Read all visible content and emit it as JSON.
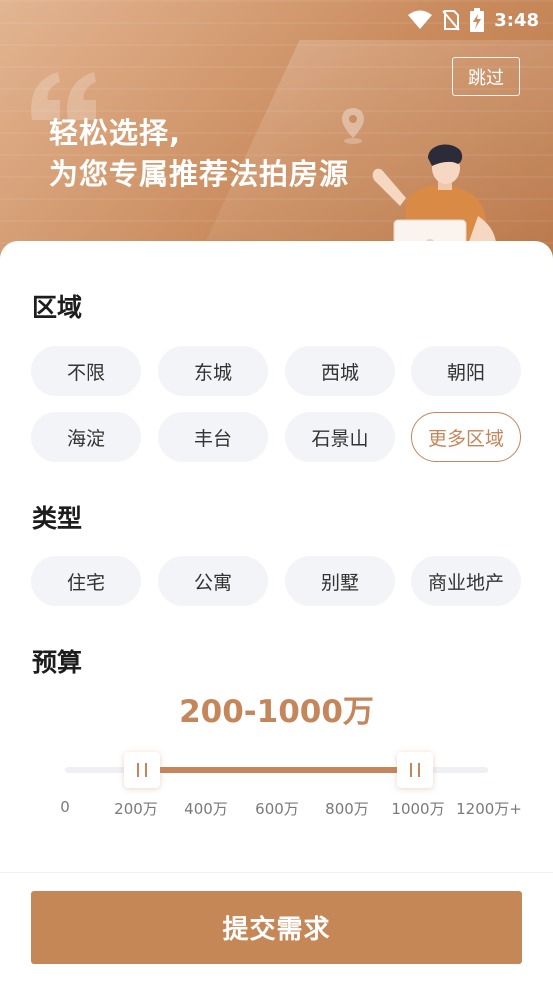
{
  "status_bar": {
    "time": "3:48"
  },
  "header": {
    "skip_label": "跳过",
    "headline_line1": "轻松选择,",
    "headline_line2": "为您专属推荐法拍房源"
  },
  "district": {
    "title": "区域",
    "options": [
      "不限",
      "东城",
      "西城",
      "朝阳",
      "海淀",
      "丰台",
      "石景山",
      "更多区域"
    ]
  },
  "type": {
    "title": "类型",
    "options": [
      "住宅",
      "公寓",
      "别墅",
      "商业地产"
    ]
  },
  "budget": {
    "title": "预算",
    "value": "200-1000万",
    "range_min": 0,
    "range_max": 1200,
    "selected_low": 200,
    "selected_high": 1000,
    "ticks": [
      "0",
      "200万",
      "400万",
      "600万",
      "800万",
      "1000万",
      "1200万+"
    ]
  },
  "submit_label": "提交需求",
  "colors": {
    "accent": "#c4865a",
    "chip_bg": "#f3f4f7",
    "button": "#c68757"
  },
  "icons": [
    "wifi-icon",
    "no-sim-icon",
    "battery-charging-icon",
    "quote-icon",
    "location-pin-icon",
    "person-laptop-illustration"
  ]
}
